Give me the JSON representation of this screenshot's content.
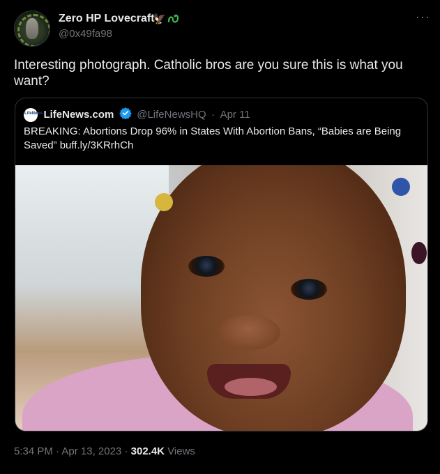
{
  "author": {
    "name": "Zero HP Lovecraft",
    "handle": "@0x49fa98",
    "badge_emoji": "🦅",
    "badge_icon": "snake-icon"
  },
  "more_label": "···",
  "tweet": {
    "text": "Interesting photograph. Catholic bros are you sure this is what you want?"
  },
  "quote": {
    "logo_text": "LifeNews",
    "name": "LifeNews.com",
    "verified_icon": "verified-badge-icon",
    "handle": "@LifeNewsHQ",
    "separator": "·",
    "date": "Apr 11",
    "text": "BREAKING: Abortions Drop 96% in States With Abortion Bans, “Babies are Being Saved” ",
    "link": "buff.ly/3KRrhCh",
    "image": "baby-photo"
  },
  "footer": {
    "time": "5:34 PM",
    "separator": "·",
    "date": "Apr 13, 2023",
    "views_count": "302.4K",
    "views_label": "Views"
  },
  "colors": {
    "background": "#000000",
    "text": "#e7e9ea",
    "muted": "#71767b",
    "border": "#2f3336",
    "verified": "#1d9bf0"
  }
}
